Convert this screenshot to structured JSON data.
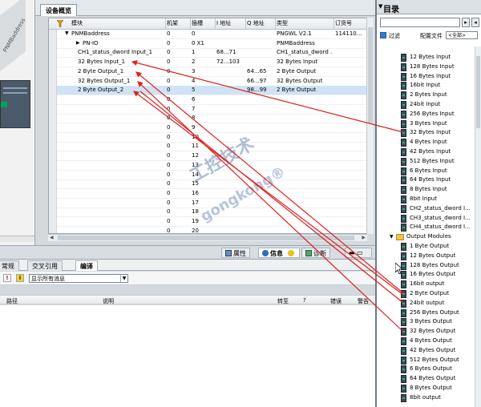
{
  "device_overview": {
    "tab_label": "设备概览",
    "columns": [
      "模块",
      "机架",
      "插槽",
      "I 地址",
      "Q 地址",
      "类型",
      "订货号"
    ],
    "rows": [
      {
        "module": "PNMBaddress",
        "rack": "0",
        "slot": "0",
        "i": "",
        "q": "",
        "type": "PNGWL V2.1",
        "order": "114110..."
      },
      {
        "module": "PN-IO",
        "rack": "0",
        "slot": "0 X1",
        "i": "",
        "q": "",
        "type": "PNMBaddress",
        "order": ""
      },
      {
        "module": "CH1_status_dword Input_1",
        "rack": "0",
        "slot": "1",
        "i": "68...71",
        "q": "",
        "type": "CH1_status_dword ...",
        "order": ""
      },
      {
        "module": "32 Bytes Input_1",
        "rack": "0",
        "slot": "2",
        "i": "72...103",
        "q": "",
        "type": "32 Bytes Input",
        "order": ""
      },
      {
        "module": "2 Byte Output_1",
        "rack": "0",
        "slot": "3",
        "i": "",
        "q": "64...65",
        "type": "2 Byte Output",
        "order": ""
      },
      {
        "module": "32 Bytes Output_1",
        "rack": "0",
        "slot": "4",
        "i": "",
        "q": "66...97",
        "type": "32 Bytes Output",
        "order": ""
      },
      {
        "module": "2 Byte Output_2",
        "rack": "0",
        "slot": "5",
        "i": "",
        "q": "98...99",
        "type": "2 Byte Output",
        "order": ""
      },
      {
        "module": "",
        "rack": "0",
        "slot": "6",
        "i": "",
        "q": "",
        "type": "",
        "order": ""
      },
      {
        "module": "",
        "rack": "0",
        "slot": "7",
        "i": "",
        "q": "",
        "type": "",
        "order": ""
      },
      {
        "module": "",
        "rack": "0",
        "slot": "8",
        "i": "",
        "q": "",
        "type": "",
        "order": ""
      },
      {
        "module": "",
        "rack": "0",
        "slot": "9",
        "i": "",
        "q": "",
        "type": "",
        "order": ""
      },
      {
        "module": "",
        "rack": "0",
        "slot": "10",
        "i": "",
        "q": "",
        "type": "",
        "order": ""
      },
      {
        "module": "",
        "rack": "0",
        "slot": "11",
        "i": "",
        "q": "",
        "type": "",
        "order": ""
      },
      {
        "module": "",
        "rack": "0",
        "slot": "12",
        "i": "",
        "q": "",
        "type": "",
        "order": ""
      },
      {
        "module": "",
        "rack": "0",
        "slot": "13",
        "i": "",
        "q": "",
        "type": "",
        "order": ""
      },
      {
        "module": "",
        "rack": "0",
        "slot": "14",
        "i": "",
        "q": "",
        "type": "",
        "order": ""
      },
      {
        "module": "",
        "rack": "0",
        "slot": "15",
        "i": "",
        "q": "",
        "type": "",
        "order": ""
      },
      {
        "module": "",
        "rack": "0",
        "slot": "16",
        "i": "",
        "q": "",
        "type": "",
        "order": ""
      },
      {
        "module": "",
        "rack": "0",
        "slot": "17",
        "i": "",
        "q": "",
        "type": "",
        "order": ""
      },
      {
        "module": "",
        "rack": "0",
        "slot": "18",
        "i": "",
        "q": "",
        "type": "",
        "order": ""
      },
      {
        "module": "",
        "rack": "0",
        "slot": "19",
        "i": "",
        "q": "",
        "type": "",
        "order": ""
      },
      {
        "module": "",
        "rack": "0",
        "slot": "20",
        "i": "",
        "q": "",
        "type": "",
        "order": ""
      }
    ]
  },
  "left_canvas": {
    "label": "PNMBaddress"
  },
  "inspector_tabs": {
    "properties": "属性",
    "info": "信息",
    "diagnostics": "诊断"
  },
  "lower_panel": {
    "tabs": [
      "常规",
      "交叉引用",
      "编译"
    ],
    "message_filter": "显示所有消息",
    "columns": {
      "path": "路径",
      "description": "说明",
      "goto": "转至",
      "q": "?",
      "errors": "错误",
      "warnings": "警告"
    }
  },
  "catalog": {
    "title": "目录",
    "filter_label": "过滤",
    "profile_label": "配置文件",
    "profile_value": "<全部>",
    "input_items": [
      "12 Bytes Input",
      "128 Bytes Input",
      "16 Bytes Input",
      "16bit Input",
      "2 Bytes Input",
      "24bit Input",
      "256 Bytes Input",
      "3 Bytes Input",
      "32 Bytes Input",
      "4 Bytes Input",
      "42 Bytes Input",
      "512 Bytes Input",
      "6 Bytes Input",
      "64 Bytes Input",
      "8 Bytes Input",
      "8bit Input",
      "CH2_status_dword I...",
      "CH3_status_dword I...",
      "CH4_status_dword I..."
    ],
    "output_folder": "Output Modules",
    "output_items": [
      "1 Byte Output",
      "12 Bytes Output",
      "128 Bytes Output",
      "16 Bytes Output",
      "16bit output",
      "2 Byte Output",
      "24bit output",
      "256 Bytes Output",
      "3 Bytes Output",
      "32 Bytes Output",
      "4 Bytes Output",
      "42 Bytes Output",
      "512 Bytes Output",
      "6 Bytes Output",
      "64 Bytes Output",
      "8 Bytes Output",
      "8bit output"
    ]
  },
  "watermark": {
    "line1": "工控技术",
    "line2": "gongkong®"
  },
  "colors": {
    "arrow": "#e02020",
    "selected_row": "#cfe3f4",
    "accent": "#2f7bd0"
  }
}
